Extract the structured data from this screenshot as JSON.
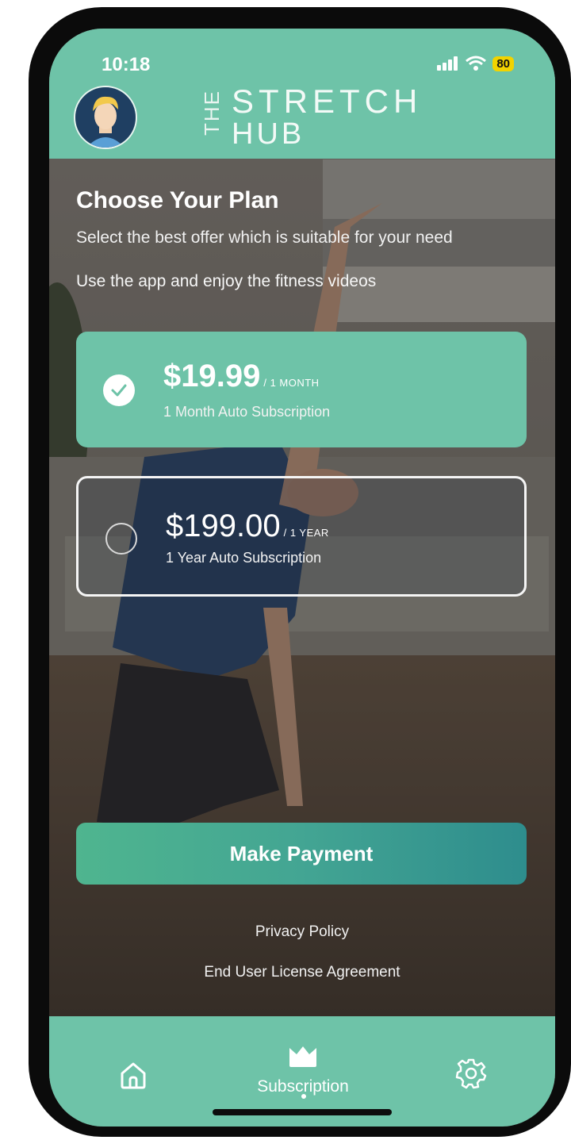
{
  "status_bar": {
    "time": "10:18",
    "battery": "80"
  },
  "header": {
    "logo_the": "THE",
    "logo_stretch": "STRETCH",
    "logo_hub": "HUB",
    "avatar_icon": "user-avatar-icon"
  },
  "page": {
    "title": "Choose Your Plan",
    "subtitle": "Select the best offer which is suitable for your need",
    "subtitle2": "Use the app and enjoy the fitness videos"
  },
  "plans": [
    {
      "price": "$19.99",
      "period": "/ 1 MONTH",
      "description": "1 Month Auto Subscription",
      "selected": true
    },
    {
      "price": "$199.00",
      "period": "/ 1 YEAR",
      "description": "1 Year Auto Subscription",
      "selected": false
    }
  ],
  "actions": {
    "make_payment": "Make Payment",
    "privacy_policy": "Privacy Policy",
    "eula": "End User License Agreement"
  },
  "tabbar": {
    "home_icon": "home-icon",
    "subscription_label": "Subscription",
    "subscription_icon": "crown-icon",
    "settings_icon": "gear-icon"
  },
  "colors": {
    "accent": "#6ec3a8",
    "button_start": "#4fb58f",
    "button_end": "#2e8d8d"
  }
}
